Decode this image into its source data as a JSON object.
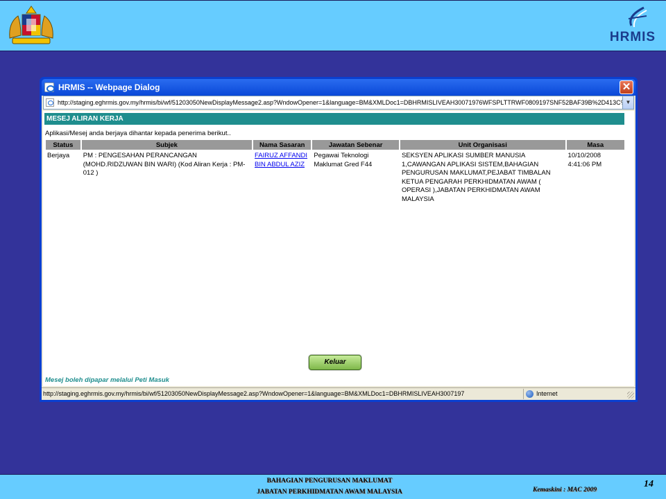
{
  "banner": {
    "crest_icon": "malaysia-coat-of-arms-icon",
    "logo_text": "HRMIS"
  },
  "dialog": {
    "title": "HRMIS -- Webpage Dialog",
    "address": "http://staging.eghrmis.gov.my/hrmis/bi/wf/51203050NewDisplayMessage2.asp?WndowOpener=1&language=BM&XMLDoc1=DBHRMISLIVEAH30071976WFSPLTTRWF0809197SNF52BAF39B%2D413C%",
    "section_title": "MESEJ ALIRAN KERJA",
    "notice": "Aplikasi/Mesej anda berjaya dihantar kepada penerima berikut..",
    "table": {
      "headers": [
        "Status",
        "Subjek",
        "Nama Sasaran",
        "Jawatan Sebenar",
        "Unit Organisasi",
        "Masa"
      ],
      "row": {
        "status": "Berjaya",
        "subjek": "PM : PENGESAHAN PERANCANGAN (MOHD.RIDZUWAN BIN WARI) (Kod Aliran Kerja : PM-012 )",
        "nama_sasaran": "FAIRUZ AFFANDI BIN ABDUL AZIZ",
        "jawatan": "Pegawai Teknologi Maklumat Gred F44",
        "unit": "SEKSYEN APLIKASI SUMBER MANUSIA 1,CAWANGAN APLIKASI SISTEM,BAHAGIAN PENGURUSAN MAKLUMAT,PEJABAT TIMBALAN KETUA PENGARAH PERKHIDMATAN AWAM ( OPERASI ),JABATAN PERKHIDMATAN AWAM MALAYSIA",
        "masa": "10/10/2008 4:41:06 PM"
      }
    },
    "button_label": "Keluar",
    "footnote": "Mesej boleh dipapar melalui Peti Masuk",
    "status_url": "http://staging.eghrmis.gov.my/hrmis/bi/wf/51203050NewDisplayMessage2.asp?WndowOpener=1&language=BM&XMLDoc1=DBHRMISLIVEAH3007197",
    "status_zone": "Internet"
  },
  "footer": {
    "line1": "BAHAGIAN PENGURUSAN MAKLUMAT",
    "line2": "JABATAN PERKHIDMATAN AWAM MALAYSIA",
    "date": "Kemaskini : MAC 2009",
    "page": "14"
  },
  "colors": {
    "background": "#33339a",
    "banner": "#66ccff",
    "section_header": "#1f8e8e",
    "button": "#9bd26a"
  }
}
